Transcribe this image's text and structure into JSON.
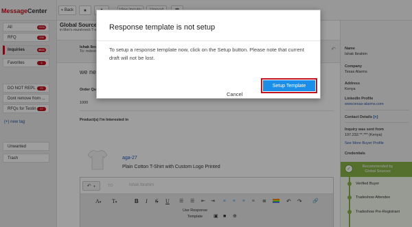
{
  "app": {
    "logo_text": "Message",
    "logo_text_accent": "Center"
  },
  "sidebar": {
    "items": [
      {
        "label": "All",
        "count": "1000"
      },
      {
        "label": "RFQ",
        "count": "288"
      },
      {
        "label": "Inquiries",
        "count": "4621"
      },
      {
        "label": "Favorites",
        "count": "4"
      },
      {
        "label": "DO NOT REPL",
        "count": "23"
      },
      {
        "label": "Dont remove from ...",
        "count": ""
      },
      {
        "label": "RFQs for Testin",
        "count": "17"
      }
    ],
    "new_tag": "(+) new tag",
    "unwanted": "Unwanted",
    "trash": "Trash"
  },
  "toolbar": {
    "back_label": "« Back",
    "view_inquiry_label": "View Inquiry",
    "unread_label": "Unread"
  },
  "message": {
    "subject": "Global Sources",
    "subject_sub": "in Men's round-neck T-s",
    "sender": "Ishak Ibrahim",
    "to_line": "To: mdester",
    "body_preview": "we need",
    "order_qty_label": "Order Quan",
    "order_qty_value": "1000",
    "products_label": "Product(s) I'm Interested in",
    "product_code": "aga-27",
    "product_desc": "Plain Cotton T-Shirt with Custom Logo Printed"
  },
  "editor": {
    "to_label": "TO",
    "to_name": "Ishak Ibrahim",
    "font_label": "A",
    "size_label": "T",
    "bold": "B",
    "italic": "I",
    "strike": "S",
    "underline": "U",
    "use_template_label": "Use Response Template"
  },
  "right_panel": {
    "name_label": "Name",
    "name_value": "Ishak Ibrahim",
    "company_label": "Company",
    "company_value": "Texas Alarms",
    "address_label": "Address",
    "address_value": "Kenya",
    "linkedin_label": "LinkedIn Profile",
    "linkedin_value": "www.texas-alarms.com",
    "contact_label": "Contact Details",
    "contact_plus": "[+]",
    "inquiry_label": "Inquiry was sent from",
    "inquiry_value": "197.232.**.*** (Kenya)",
    "more_buyer": "See More Buyer Profile",
    "credentials_label": "Credentials",
    "recommended": "Recommended by Global Sources",
    "creds": [
      "Verified Buyer",
      "Tradeshow Attendee",
      "Tradeshow Pre-Registrant"
    ]
  },
  "modal": {
    "title": "Response template is not setup",
    "body": "To setup a response template now, click on the Setup button. Please note that current draft will not be lost.",
    "cancel_label": "Cancel",
    "setup_label": "Setup Template"
  },
  "colors": {
    "brand_red": "#c1121f",
    "setup_blue": "#1a8ee8",
    "credential_green": "#8ab34a"
  }
}
